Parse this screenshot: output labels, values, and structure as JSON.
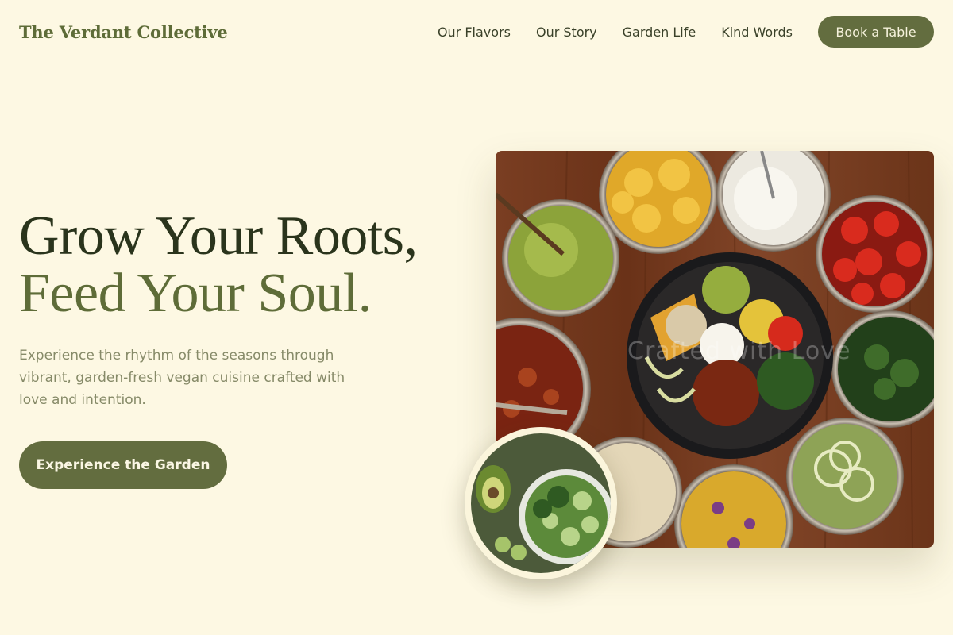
{
  "header": {
    "logo": "The Verdant Collective",
    "nav": [
      "Our Flavors",
      "Our Story",
      "Garden Life",
      "Kind Words"
    ],
    "cta": "Book a Table"
  },
  "hero": {
    "headline_line1": "Grow Your Roots,",
    "headline_line2": "Feed Your Soul.",
    "subtitle": "Experience the rhythm of the seasons through vibrant, garden-fresh vegan cuisine crafted with love and intention.",
    "cta": "Experience the Garden",
    "watermark": "Crafted with Love"
  },
  "images": {
    "main": "vegan-bowl-spread-photo",
    "secondary": "green-salad-photo"
  },
  "colors": {
    "background": "#fdf8e3",
    "accent": "#636d3f",
    "headline_dark": "#2a341c",
    "headline_green": "#5e6c38",
    "body_text": "#868a68"
  }
}
